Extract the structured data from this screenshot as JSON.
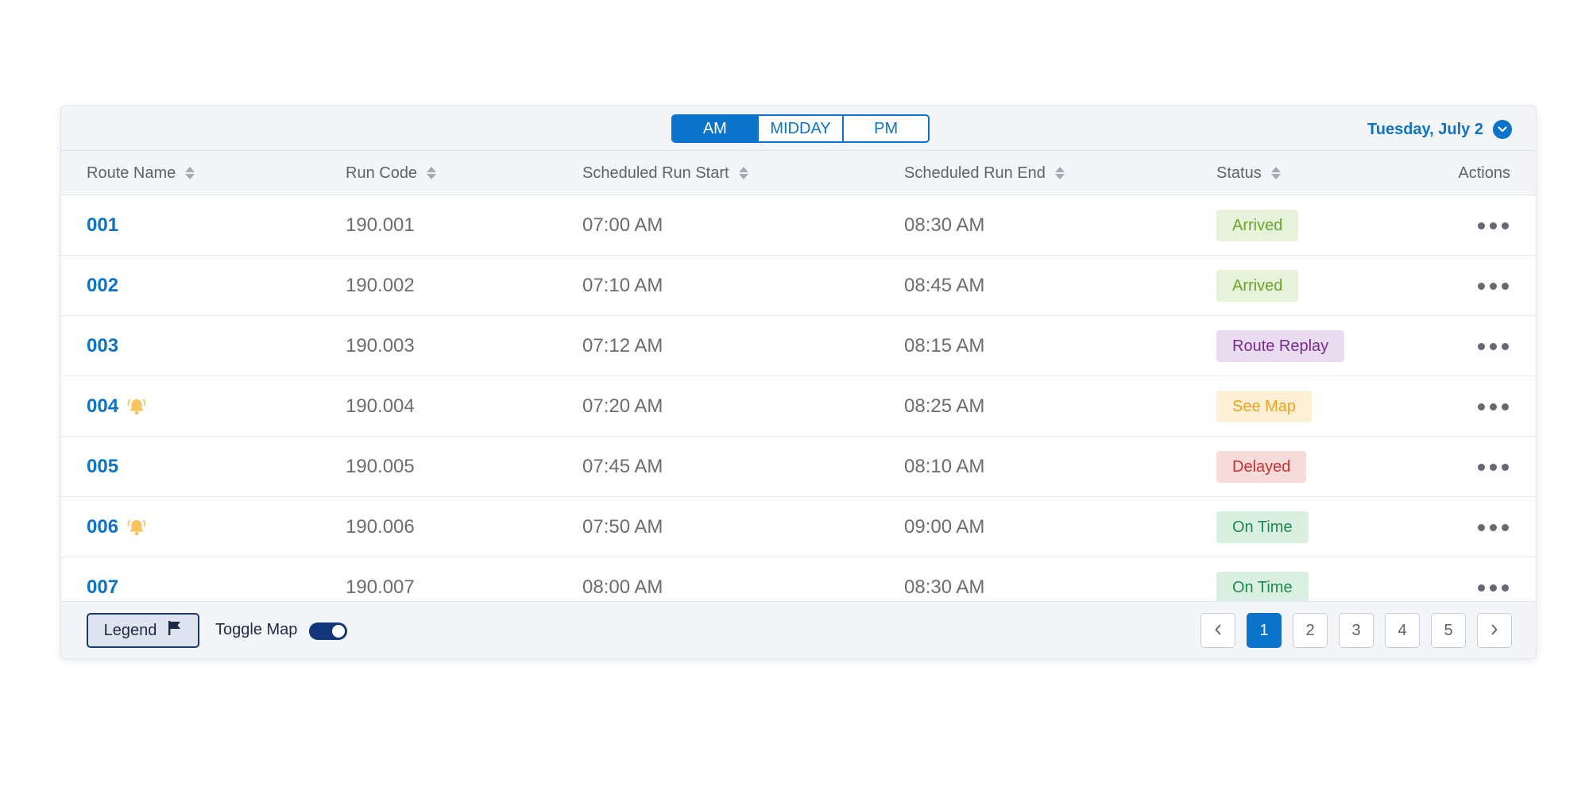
{
  "toolbar": {
    "periods": [
      "AM",
      "MIDDAY",
      "PM"
    ],
    "active_period": "AM",
    "date": "Tuesday, July 2"
  },
  "columns": {
    "route_name": "Route Name",
    "run_code": "Run Code",
    "scheduled_start": "Scheduled Run Start",
    "scheduled_end": "Scheduled Run End",
    "status": "Status",
    "actions": "Actions"
  },
  "rows": [
    {
      "route": "001",
      "alert": false,
      "run_code": "190.001",
      "start": "07:00 AM",
      "end": "08:30 AM",
      "status": "Arrived",
      "status_bg": "#e6f2da",
      "status_fg": "#6aa52c"
    },
    {
      "route": "002",
      "alert": false,
      "run_code": "190.002",
      "start": "07:10 AM",
      "end": "08:45 AM",
      "status": "Arrived",
      "status_bg": "#e6f2da",
      "status_fg": "#6aa52c"
    },
    {
      "route": "003",
      "alert": false,
      "run_code": "190.003",
      "start": "07:12 AM",
      "end": "08:15 AM",
      "status": "Route Replay",
      "status_bg": "#eadcf0",
      "status_fg": "#7a2a8e"
    },
    {
      "route": "004",
      "alert": true,
      "run_code": "190.004",
      "start": "07:20 AM",
      "end": "08:25 AM",
      "status": "See Map",
      "status_bg": "#fdefd5",
      "status_fg": "#f0a21a"
    },
    {
      "route": "005",
      "alert": false,
      "run_code": "190.005",
      "start": "07:45 AM",
      "end": "08:10 AM",
      "status": "Delayed",
      "status_bg": "#f8dcdc",
      "status_fg": "#c9302c"
    },
    {
      "route": "006",
      "alert": true,
      "run_code": "190.006",
      "start": "07:50 AM",
      "end": "09:00 AM",
      "status": "On Time",
      "status_bg": "#d9efe2",
      "status_fg": "#1e8a4c"
    },
    {
      "route": "007",
      "alert": false,
      "run_code": "190.007",
      "start": "08:00 AM",
      "end": "08:30 AM",
      "status": "On Time",
      "status_bg": "#d9efe2",
      "status_fg": "#1e8a4c"
    }
  ],
  "footer": {
    "legend_label": "Legend",
    "toggle_map_label": "Toggle Map",
    "toggle_map_on": true,
    "pages": [
      "1",
      "2",
      "3",
      "4",
      "5"
    ],
    "current_page": "1"
  },
  "colors": {
    "accent": "#0b73c9",
    "alert": "#f7c35f",
    "navy": "#13357a"
  },
  "icons": {
    "sort": "sort-icon",
    "date": "chevron-down-icon",
    "alert": "bell-icon",
    "actions": "more-horizontal-icon",
    "legend": "flag-icon",
    "prev": "chevron-left-icon",
    "next": "chevron-right-icon"
  }
}
